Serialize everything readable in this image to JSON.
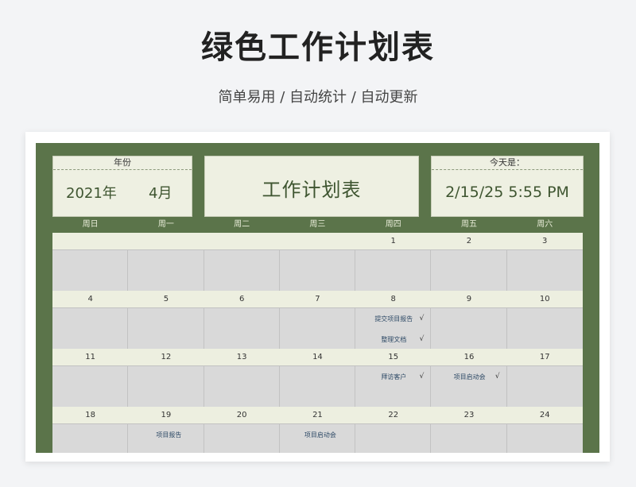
{
  "header": {
    "title": "绿色工作计划表",
    "subtitle": "简单易用 / 自动统计 / 自动更新"
  },
  "sheet": {
    "year_label": "年份",
    "year_value": "2021年",
    "month_value": "4月",
    "main_title": "工作计划表",
    "today_label": "今天是：",
    "today_value": "2/15/25 5:55 PM",
    "weekdays": [
      "周日",
      "周一",
      "周二",
      "周三",
      "周四",
      "周五",
      "周六"
    ],
    "weeks": [
      {
        "days": [
          "",
          "",
          "",
          "",
          "1",
          "2",
          "3"
        ],
        "tasks": [
          [],
          [],
          [],
          [],
          [],
          [],
          []
        ]
      },
      {
        "days": [
          "4",
          "5",
          "6",
          "7",
          "8",
          "9",
          "10"
        ],
        "tasks": [
          [],
          [],
          [],
          [],
          [
            {
              "name": "提交项目报告",
              "check": "√"
            },
            {
              "name": "整理文档",
              "check": "√"
            }
          ],
          [],
          []
        ]
      },
      {
        "days": [
          "11",
          "12",
          "13",
          "14",
          "15",
          "16",
          "17"
        ],
        "tasks": [
          [],
          [],
          [],
          [],
          [
            {
              "name": "拜访客户",
              "check": "√"
            }
          ],
          [
            {
              "name": "项目启动会",
              "check": "√"
            }
          ],
          []
        ]
      },
      {
        "days": [
          "18",
          "19",
          "20",
          "21",
          "22",
          "23",
          "24"
        ],
        "tasks": [
          [],
          [
            {
              "name": "项目报告",
              "check": ""
            }
          ],
          [],
          [
            {
              "name": "项目启动会",
              "check": ""
            }
          ],
          [],
          [],
          []
        ]
      }
    ]
  },
  "colors": {
    "sheet_bg": "#5b744a",
    "panel_bg": "#eef0e2",
    "cell_bg": "#d9d9d9",
    "accent_text": "#3e5530"
  }
}
